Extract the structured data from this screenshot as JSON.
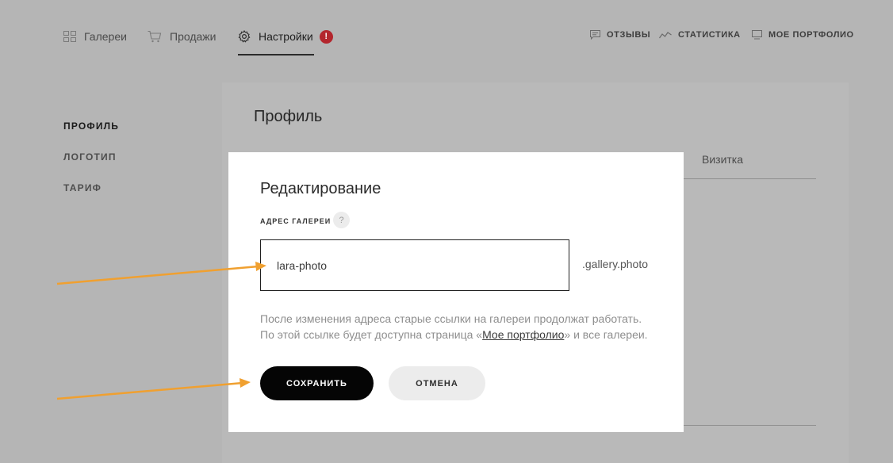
{
  "nav": {
    "items": [
      {
        "label": "Галереи",
        "icon": "grid-icon"
      },
      {
        "label": "Продажи",
        "icon": "cart-icon"
      },
      {
        "label": "Настройки",
        "icon": "gear-icon",
        "active": true,
        "badge": "!"
      }
    ],
    "right_links": [
      {
        "label": "ОТЗЫВЫ",
        "icon": "comment-icon"
      },
      {
        "label": "СТАТИСТИКА",
        "icon": "chart-icon"
      },
      {
        "label": "МОЕ ПОРТФОЛИО",
        "icon": "monitor-icon"
      }
    ]
  },
  "sidebar": {
    "items": [
      {
        "label": "ПРОФИЛЬ",
        "active": true
      },
      {
        "label": "ЛОГОТИП"
      },
      {
        "label": "ТАРИФ"
      }
    ]
  },
  "card": {
    "title": "Профиль",
    "tab_label": "Визитка"
  },
  "modal": {
    "title": "Редактирование",
    "field_label": "АДРЕС ГАЛЕРЕИ",
    "help": "?",
    "input_value": "lara-photo",
    "suffix": ".gallery.photo",
    "hint_line1": "После изменения адреса старые ссылки на галереи продолжат работать.",
    "hint_line2_prefix": "По этой ссылке будет доступна страница «",
    "hint_link": "Мое портфолио",
    "hint_line2_suffix": "» и все галереи.",
    "save_label": "СОХРАНИТЬ",
    "cancel_label": "ОТМЕНА"
  },
  "colors": {
    "overlay": "#b5b5b5",
    "badge": "#b3262d",
    "arrow": "#f0a030",
    "primary_button": "#050505",
    "secondary_button": "#ececec"
  }
}
